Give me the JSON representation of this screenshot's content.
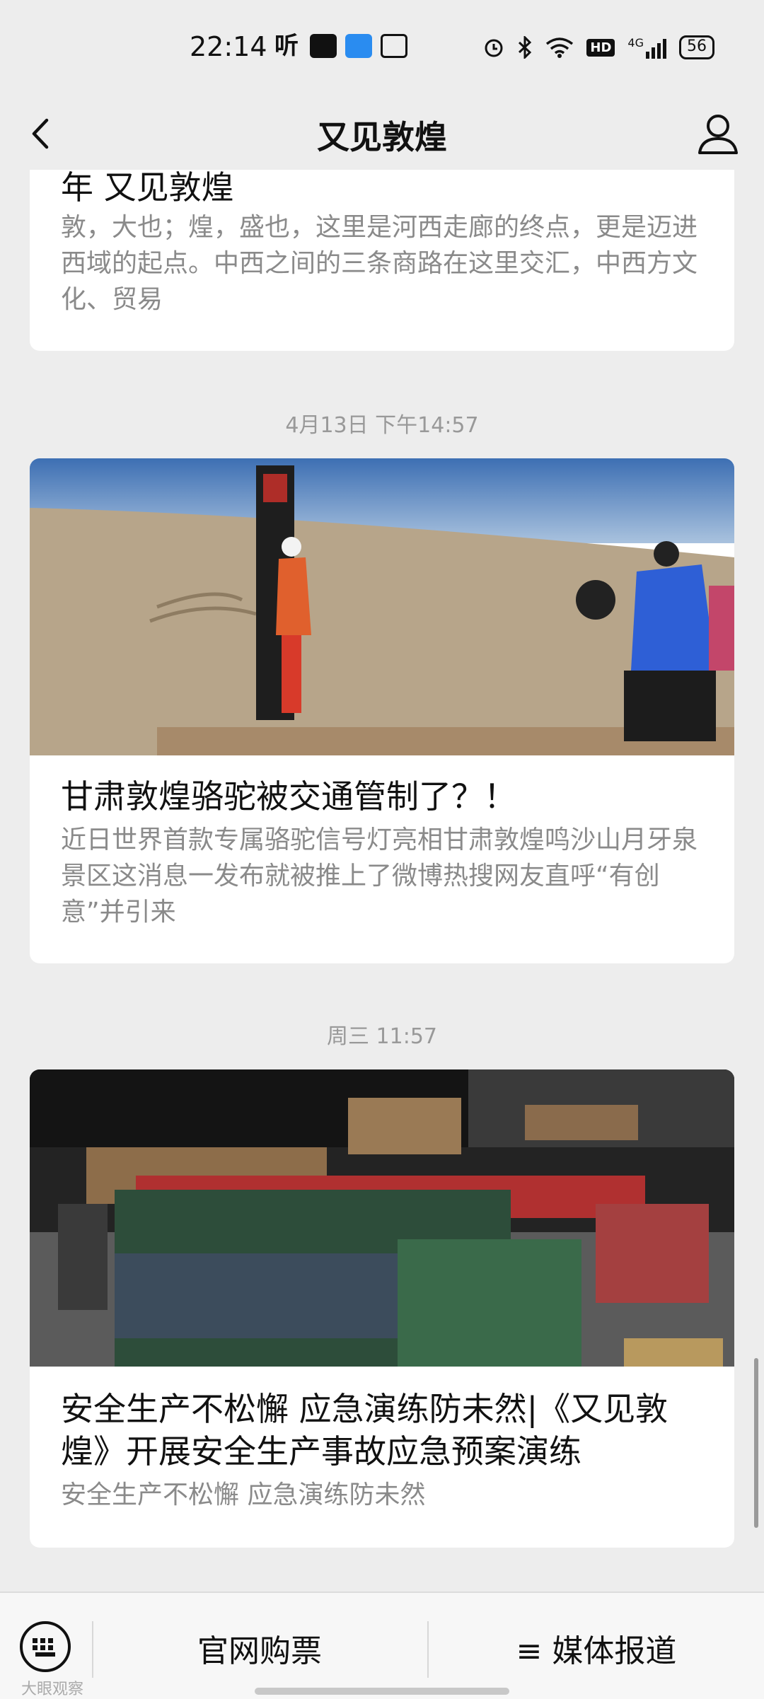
{
  "status_bar": {
    "time": "22:14",
    "left_icons": [
      "listen-icon",
      "tiktok-icon",
      "tencent-icon",
      "iqiyi-icon"
    ],
    "right_icons": [
      "alarm-icon",
      "bluetooth-icon",
      "wifi-icon",
      "hd-icon",
      "signal-icon"
    ],
    "network": "4G",
    "battery": "56"
  },
  "navbar": {
    "title": "又见敦煌",
    "back_icon": "back-arrow-icon",
    "profile_icon": "user-icon"
  },
  "feed": [
    {
      "date": "",
      "title": "年  又见敦煌",
      "desc": "敦，大也；煌，盛也，这里是河西走廊的终点，更是迈进西域的起点。中西之间的三条商路在这里交汇，中西方文化、贸易"
    },
    {
      "date": "4月13日 下午14:57",
      "title": "甘肃敦煌骆驼被交通管制了？！",
      "desc": "近日世界首款专属骆驼信号灯亮相甘肃敦煌鸣沙山月牙泉景区这消息一发布就被推上了微博热搜网友直呼“有创意”并引来"
    },
    {
      "date": "周三 11:57",
      "title": "安全生产不松懈 应急演练防未然|《又见敦煌》开展安全生产事故应急预案演练",
      "desc": "安全生产不松懈 应急演练防未然"
    }
  ],
  "bottom_menu": {
    "keyboard_icon": "keyboard-icon",
    "item1": "官网购票",
    "item2": "≡ 媒体报道"
  },
  "watermark": "大眼观察"
}
